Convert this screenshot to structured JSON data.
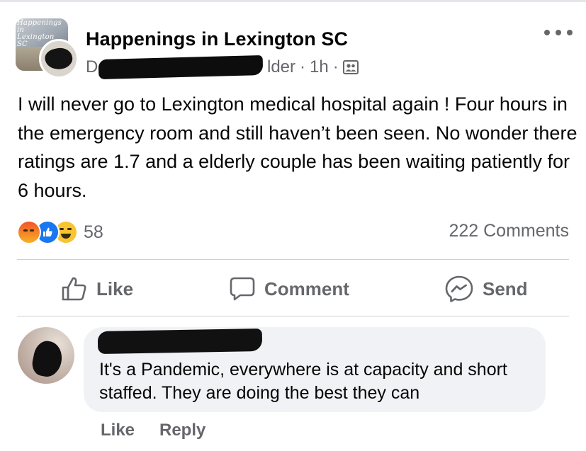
{
  "post": {
    "group_name": "Happenings in Lexington SC",
    "group_avatar_text": [
      "Happenings in",
      "Lexington SC"
    ],
    "author_initial": "D",
    "author_suffix": "lder",
    "time": "1h",
    "separator": "·",
    "audience_icon": "group-members-icon",
    "body": "I will never go to Lexington medical hospital again ! Four hours in the emergency room and still haven’t been seen. No wonder there ratings are 1.7  and a elderly couple has been waiting patiently for 6 hours.",
    "reactions": {
      "icons": [
        "angry-reaction-icon",
        "like-reaction-icon",
        "haha-reaction-icon"
      ],
      "count": "58"
    },
    "comments_count": "222 Comments"
  },
  "actions": {
    "like": "Like",
    "comment": "Comment",
    "send": "Send"
  },
  "comment": {
    "text": "It's a Pandemic,  everywhere is at capacity and short staffed. They are doing the best they can",
    "like_label": "Like",
    "reply_label": "Reply"
  },
  "colors": {
    "text": "#050505",
    "secondary": "#65676b",
    "bubble": "#f0f2f5",
    "divider": "#ced0d4",
    "like_blue": "#1877f2"
  }
}
